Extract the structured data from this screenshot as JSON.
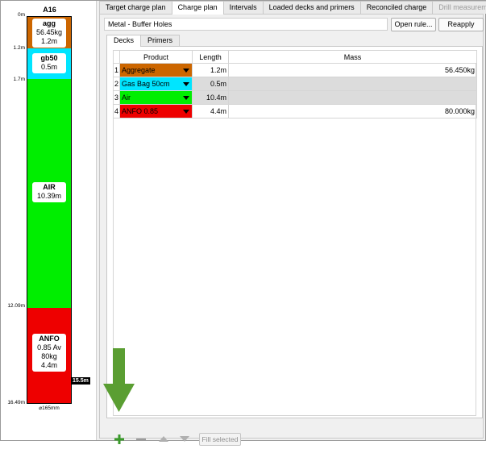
{
  "hole": {
    "title": "A16",
    "total_length": "15.5m",
    "diameter": "⌀165mm",
    "depth_labels": [
      "0m",
      "1.2m",
      "1.7m",
      "12.09m",
      "16.49m"
    ],
    "segments": [
      {
        "name": "agg",
        "lines": [
          "56.45kg",
          "1.2m"
        ],
        "color": "#cc6600"
      },
      {
        "name": "gb50",
        "lines": [
          "0.5m"
        ],
        "color": "#00e5ff"
      },
      {
        "name": "AIR",
        "lines": [
          "10.39m"
        ],
        "color": "#00ee00"
      },
      {
        "name": "ANFO",
        "lines": [
          "0.85 Av",
          "80kg",
          "4.4m"
        ],
        "color": "#ee0000"
      }
    ]
  },
  "tabs": [
    "Target charge plan",
    "Charge plan",
    "Intervals",
    "Loaded decks and primers",
    "Reconciled charge",
    "Drill measurements"
  ],
  "active_tab": "Charge plan",
  "charge_rule_name": "Metal - Buffer Holes",
  "buttons": {
    "open_rule": "Open rule...",
    "reapply": "Reapply",
    "fill_selected": "Fill selected"
  },
  "subtabs": [
    "Decks",
    "Primers"
  ],
  "table": {
    "headers": [
      "Product",
      "Length",
      "Mass"
    ],
    "rows": [
      {
        "index": "1",
        "product": "Aggregate",
        "color": "#cc6600",
        "length": "1.2m",
        "mass": "56.450kg"
      },
      {
        "index": "2",
        "product": "Gas Bag 50cm",
        "color": "#00e5ff",
        "length": "0.5m",
        "mass": ""
      },
      {
        "index": "3",
        "product": "Air",
        "color": "#00ee00",
        "length": "10.4m",
        "mass": ""
      },
      {
        "index": "4",
        "product": "ANFO 0.85",
        "color": "#ee0000",
        "length": "4.4m",
        "mass": "80.000kg"
      }
    ]
  },
  "icons": {
    "add": "plus-icon",
    "remove": "minus-icon",
    "up": "move-up-icon",
    "down": "move-down-icon",
    "pointer": "down-arrow-icon"
  },
  "colors": {
    "add_green": "#3a9a2a",
    "arrow_green": "#5a9e32"
  }
}
